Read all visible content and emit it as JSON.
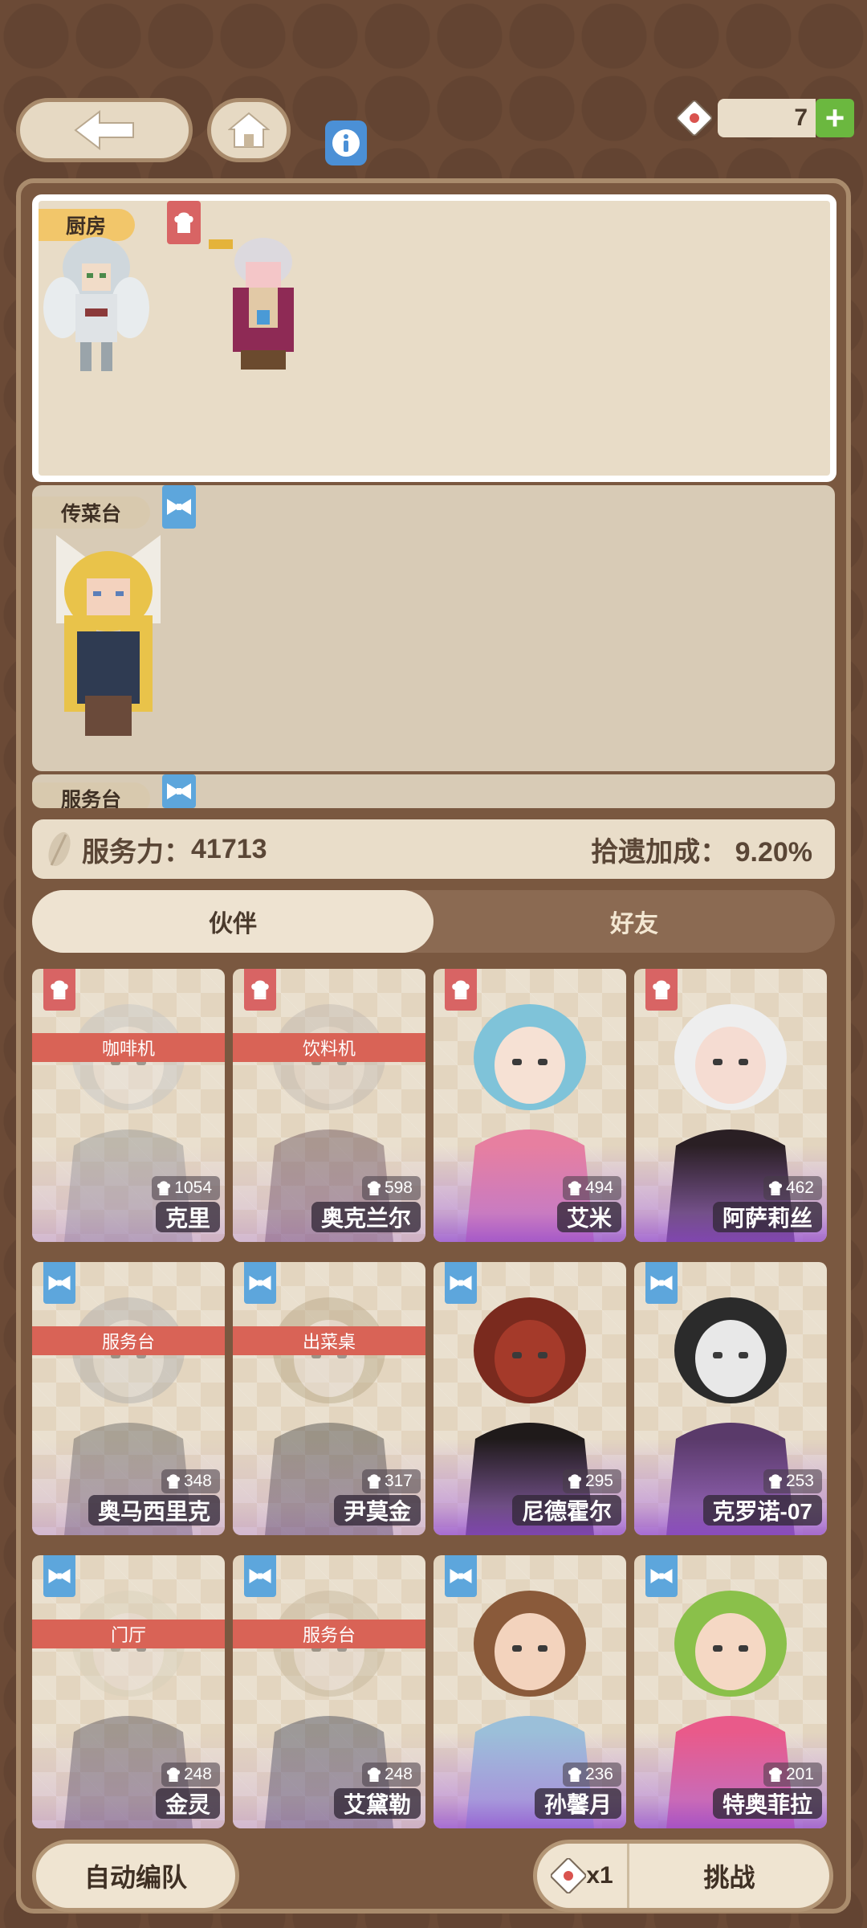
{
  "top": {
    "ticket_count": "7",
    "ticket_add": "+"
  },
  "stations": [
    {
      "label": "厨房",
      "badge": "chef-hat-icon",
      "color": "#d86464"
    },
    {
      "label": "传菜台",
      "badge": "bowtie-icon",
      "color": "#5da6dc"
    },
    {
      "label": "服务台",
      "badge": "bowtie-icon",
      "color": "#5da6dc"
    }
  ],
  "stats": {
    "service_label": "服务力：",
    "service_value": "41713",
    "bonus_label": "拾遗加成：",
    "bonus_value": "9.20%"
  },
  "tabs": [
    {
      "label": "伙伴",
      "active": true
    },
    {
      "label": "好友",
      "active": false
    }
  ],
  "characters": [
    {
      "name": "克里",
      "power": "1054",
      "assigned": "咖啡机",
      "role": "chef"
    },
    {
      "name": "奥克兰尔",
      "power": "598",
      "assigned": "饮料机",
      "role": "chef"
    },
    {
      "name": "艾米",
      "power": "494",
      "assigned": "",
      "role": "chef"
    },
    {
      "name": "阿萨莉丝",
      "power": "462",
      "assigned": "",
      "role": "chef"
    },
    {
      "name": "奥马西里克",
      "power": "348",
      "assigned": "服务台",
      "role": "waiter"
    },
    {
      "name": "尹莫金",
      "power": "317",
      "assigned": "出菜桌",
      "role": "waiter"
    },
    {
      "name": "尼德霍尔",
      "power": "295",
      "assigned": "",
      "role": "waiter"
    },
    {
      "name": "克罗诺-07",
      "power": "253",
      "assigned": "",
      "role": "waiter"
    },
    {
      "name": "金灵",
      "power": "248",
      "assigned": "门厅",
      "role": "waiter"
    },
    {
      "name": "艾黛勒",
      "power": "248",
      "assigned": "服务台",
      "role": "waiter"
    },
    {
      "name": "孙馨月",
      "power": "236",
      "assigned": "",
      "role": "waiter"
    },
    {
      "name": "特奥菲拉",
      "power": "201",
      "assigned": "",
      "role": "waiter"
    }
  ],
  "bottom": {
    "auto_label": "自动编队",
    "cost_label": "x1",
    "challenge_label": "挑战"
  }
}
